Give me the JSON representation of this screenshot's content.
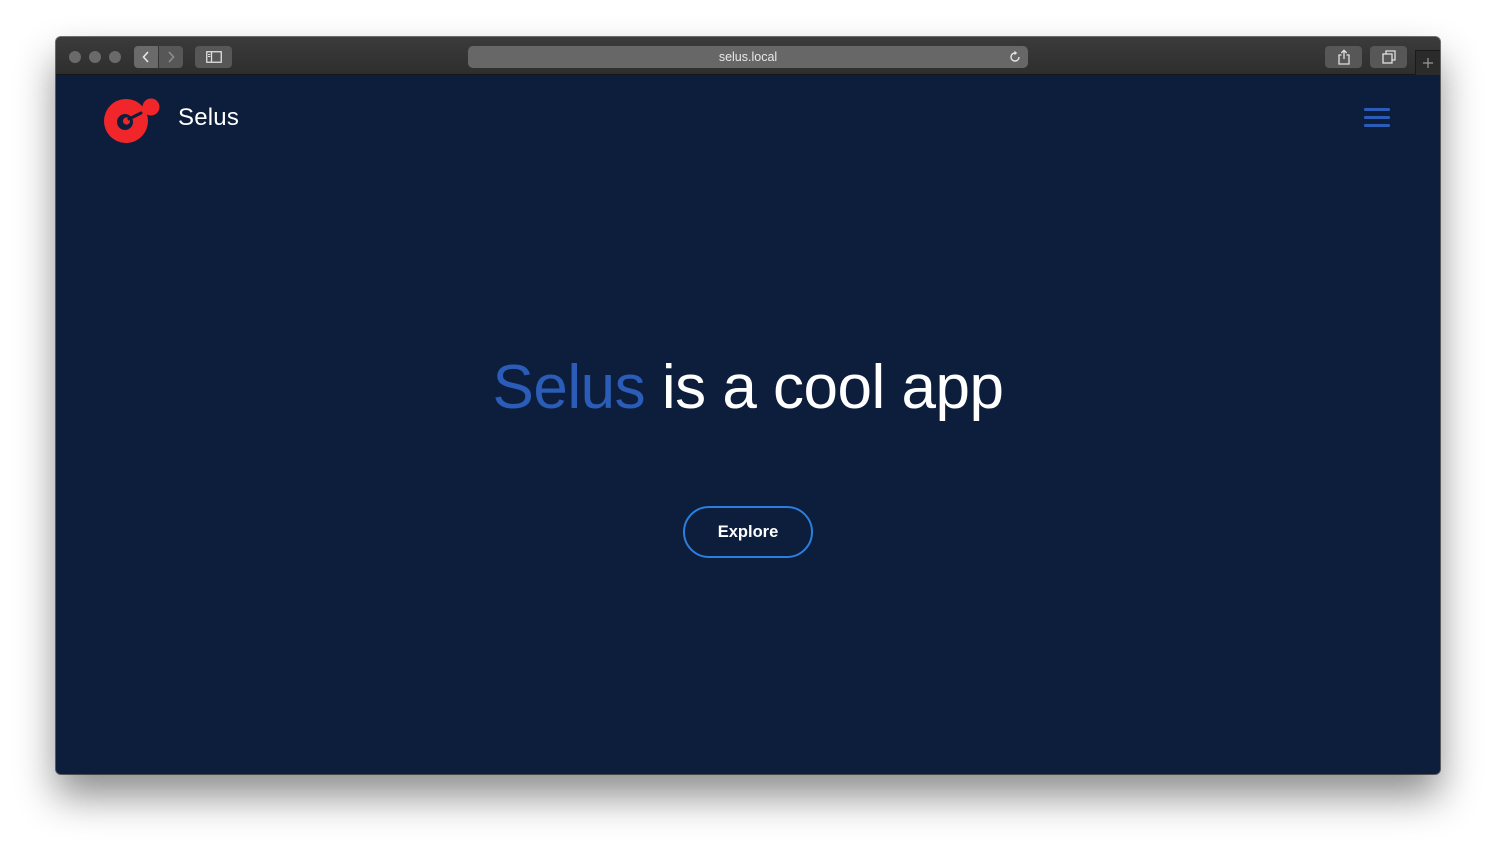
{
  "browser": {
    "url": "selus.local",
    "icons": {
      "back": "chevron-left-icon",
      "forward": "chevron-right-icon",
      "sidebar": "sidebar-icon",
      "reload": "reload-icon",
      "share": "share-icon",
      "tabs": "tabs-icon",
      "new_tab": "plus-icon"
    }
  },
  "site": {
    "brand": "Selus",
    "logo_color": "#f0262b",
    "menu_icon": "hamburger-menu-icon"
  },
  "hero": {
    "accent_word": "Selus",
    "rest": " is a cool app",
    "accent_color": "#2a5cb8"
  },
  "cta": {
    "label": "Explore",
    "border_color": "#2a7fde"
  },
  "colors": {
    "background": "#0c1e3b",
    "text": "#ffffff"
  }
}
